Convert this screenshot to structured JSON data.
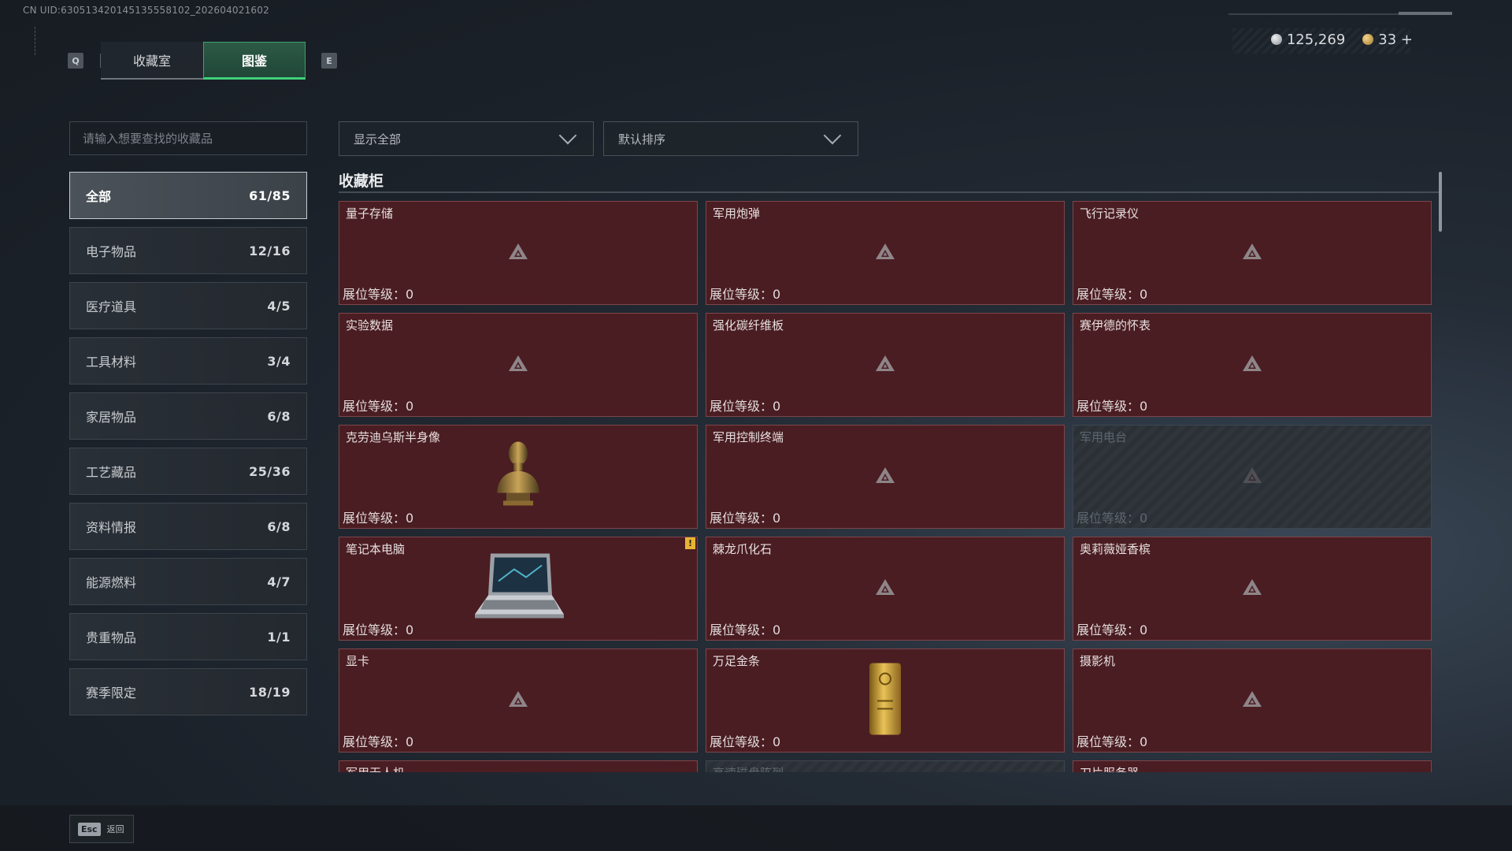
{
  "header": {
    "uid": "CN UID:630513420145135558102_202604021602",
    "left_key": "Q",
    "right_key": "E",
    "tabs": [
      {
        "label": "收藏室",
        "active": false
      },
      {
        "label": "图鉴",
        "active": true
      }
    ],
    "currency": {
      "silver_icon": "silver-coin-icon",
      "silver_value": "125,269",
      "gold_icon": "gold-coin-icon",
      "gold_value": "33 +"
    }
  },
  "filters": {
    "search_placeholder": "请输入想要查找的收藏品",
    "display_filter": "显示全部",
    "sort": "默认排序"
  },
  "categories": [
    {
      "label": "全部",
      "count": "61/85",
      "active": true
    },
    {
      "label": "电子物品",
      "count": "12/16"
    },
    {
      "label": "医疗道具",
      "count": "4/5"
    },
    {
      "label": "工具材料",
      "count": "3/4"
    },
    {
      "label": "家居物品",
      "count": "6/8"
    },
    {
      "label": "工艺藏品",
      "count": "25/36"
    },
    {
      "label": "资料情报",
      "count": "6/8"
    },
    {
      "label": "能源燃料",
      "count": "4/7"
    },
    {
      "label": "贵重物品",
      "count": "1/1"
    },
    {
      "label": "赛季限定",
      "count": "18/19"
    }
  ],
  "section": {
    "title": "收藏柜"
  },
  "items": [
    {
      "name": "量子存储",
      "level": "展位等级：0",
      "image": "placeholder"
    },
    {
      "name": "军用炮弹",
      "level": "展位等级：0",
      "image": "placeholder"
    },
    {
      "name": "飞行记录仪",
      "level": "展位等级：0",
      "image": "placeholder"
    },
    {
      "name": "实验数据",
      "level": "展位等级：0",
      "image": "placeholder"
    },
    {
      "name": "强化碳纤维板",
      "level": "展位等级：0",
      "image": "placeholder"
    },
    {
      "name": "赛伊德的怀表",
      "level": "展位等级：0",
      "image": "placeholder"
    },
    {
      "name": "克劳迪乌斯半身像",
      "level": "展位等级：0",
      "image": "bust"
    },
    {
      "name": "军用控制终端",
      "level": "展位等级：0",
      "image": "placeholder"
    },
    {
      "name": "军用电台",
      "level": "展位等级：0",
      "image": "placeholder",
      "locked": true
    },
    {
      "name": "笔记本电脑",
      "level": "展位等级：0",
      "image": "laptop",
      "badge": "!"
    },
    {
      "name": "棘龙爪化石",
      "level": "展位等级：0",
      "image": "placeholder"
    },
    {
      "name": "奥莉薇娅香槟",
      "level": "展位等级：0",
      "image": "placeholder"
    },
    {
      "name": "显卡",
      "level": "展位等级：0",
      "image": "placeholder"
    },
    {
      "name": "万足金条",
      "level": "展位等级：0",
      "image": "goldbar"
    },
    {
      "name": "摄影机",
      "level": "展位等级：0",
      "image": "placeholder"
    },
    {
      "name": "军用无人机",
      "level": "",
      "image": "placeholder"
    },
    {
      "name": "高速磁盘阵列",
      "level": "",
      "image": "placeholder",
      "locked": true
    },
    {
      "name": "刀片服务器",
      "level": "",
      "image": "placeholder"
    }
  ],
  "footer": {
    "esc_key": "Esc",
    "back_label": "返回"
  },
  "colors": {
    "card_bg": "#4a1d22",
    "card_border": "#7e454a",
    "tab_active": "#2c5a45",
    "tab_active_border": "#3fd07a",
    "badge": "#e7b533"
  }
}
